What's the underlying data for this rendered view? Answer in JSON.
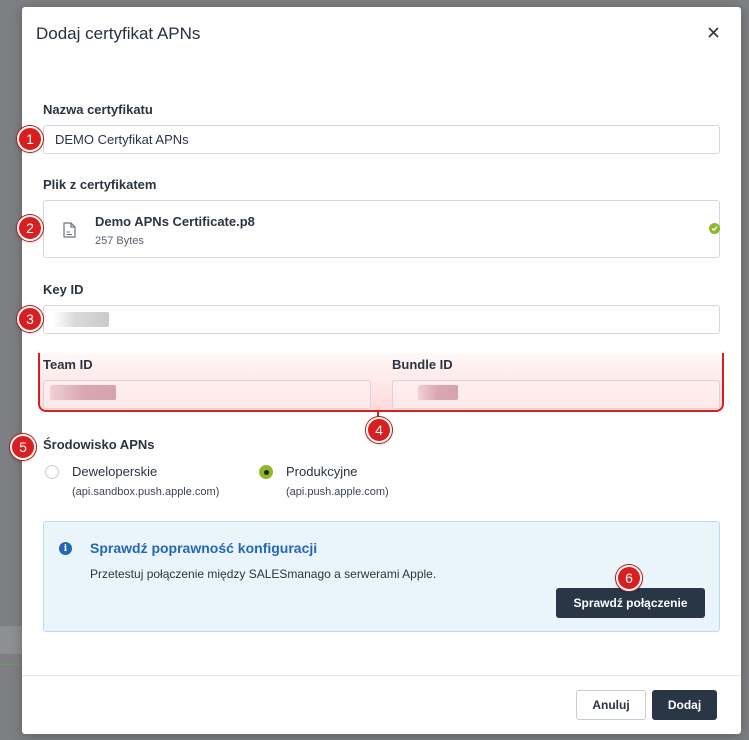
{
  "modal": {
    "title": "Dodaj certyfikat APNs",
    "close_icon": "close-icon"
  },
  "form": {
    "cert_name": {
      "label": "Nazwa certyfikatu",
      "value": "DEMO Certyfikat APNs"
    },
    "cert_file": {
      "label": "Plik z certyfikatem",
      "file_name": "Demo APNs Certificate.p8",
      "file_size": "257 Bytes",
      "status_icon": "check-circle-icon"
    },
    "key_id": {
      "label": "Key ID",
      "value": ""
    },
    "team_id": {
      "label": "Team ID",
      "value": ""
    },
    "bundle_id": {
      "label": "Bundle ID",
      "value": ""
    },
    "environment": {
      "label": "Środowisko APNs",
      "options": [
        {
          "label": "Deweloperskie",
          "sub": "(api.sandbox.push.apple.com)",
          "selected": false
        },
        {
          "label": "Produkcyjne",
          "sub": "(api.push.apple.com)",
          "selected": true
        }
      ]
    }
  },
  "info": {
    "title": "Sprawdź poprawność konfiguracji",
    "text": "Przetestuj połączenie między SALESmanago a serwerami Apple.",
    "button": "Sprawdź połączenie"
  },
  "footer": {
    "cancel": "Anuluj",
    "submit": "Dodaj"
  },
  "badges": [
    "1",
    "2",
    "3",
    "4",
    "5",
    "6"
  ],
  "colors": {
    "accent_green": "#8fb82e",
    "badge_red": "#d81e1e",
    "info_blue": "#2466b8",
    "button_dark": "#283646"
  }
}
